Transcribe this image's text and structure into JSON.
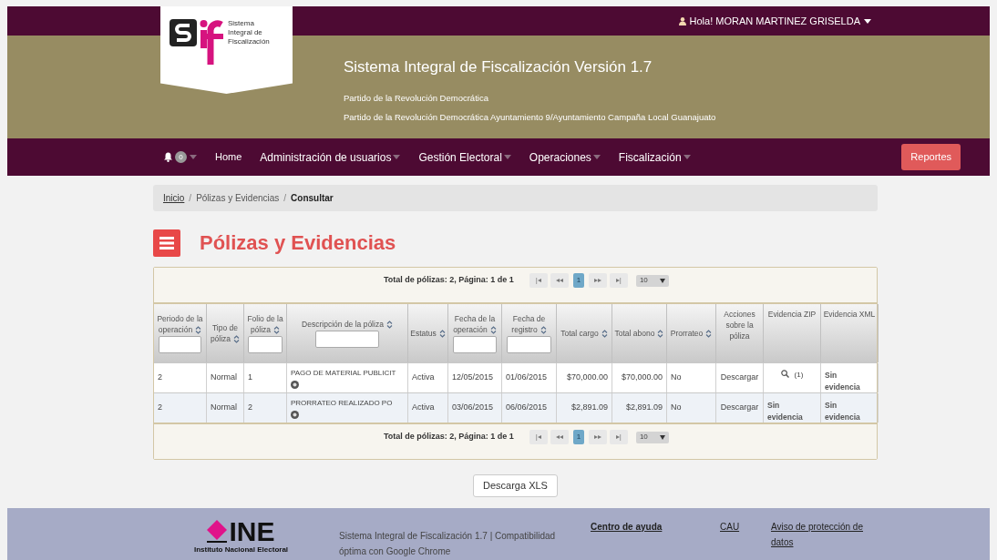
{
  "top_bar": {
    "greeting": "Hola! MORAN MARTINEZ GRISELDA"
  },
  "header": {
    "logo_text": "Sistema Integral de Fiscalización",
    "title": "Sistema Integral de Fiscalización Versión 1.7",
    "lines": [
      "Partido de la Revolución Democrática",
      "Partido de la Revolución Democrática Ayuntamiento 9/Ayuntamiento Campaña Local Guanajuato"
    ]
  },
  "nav": {
    "notification_count": "0",
    "items": [
      {
        "label": "Home",
        "dropdown": false
      },
      {
        "label": "Administración de usuarios",
        "dropdown": true
      },
      {
        "label": "Gestión Electoral",
        "dropdown": true
      },
      {
        "label": "Operaciones",
        "dropdown": true
      },
      {
        "label": "Fiscalización",
        "dropdown": true
      }
    ],
    "action": "Reportes"
  },
  "breadcrumb_separator": "/",
  "breadcrumb": [
    {
      "label": "Inicio",
      "kind": "link"
    },
    {
      "label": "Pólizas y Evidencias",
      "kind": "plain"
    },
    {
      "label": "Consultar",
      "kind": "current"
    }
  ],
  "page_title": "Pólizas y Evidencias",
  "pager_top": {
    "summary": "Total de pólizas: 2, Página: 1 de 1",
    "first": "|◂",
    "prev": "◂◂",
    "pages": [
      {
        "label": "1",
        "selected": true
      }
    ],
    "next": "▸▸",
    "last": "▸|",
    "page_size": "10"
  },
  "pager_bottom": {
    "summary": "Total de pólizas: 2, Página: 1 de 1",
    "first": "|◂",
    "prev": "◂◂",
    "pages": [
      {
        "label": "1",
        "selected": true
      }
    ],
    "next": "▸▸",
    "last": "▸|",
    "page_size": "10"
  },
  "table": {
    "columns": [
      {
        "label": "Periodo de la operación",
        "sortable": true,
        "filter": true
      },
      {
        "label": "Tipo de póliza",
        "sortable": true,
        "filter": false
      },
      {
        "label": "Folio de la póliza",
        "sortable": true,
        "filter": true
      },
      {
        "label": "Descripción de la póliza",
        "sortable": true,
        "filter": true
      },
      {
        "label": "Estatus",
        "sortable": true,
        "filter": false
      },
      {
        "label": "Fecha de la operación",
        "sortable": true,
        "filter": true
      },
      {
        "label": "Fecha de registro",
        "sortable": true,
        "filter": true
      },
      {
        "label": "Total cargo",
        "sortable": true,
        "filter": false
      },
      {
        "label": "Total abono",
        "sortable": true,
        "filter": false
      },
      {
        "label": "Prorrateo",
        "sortable": true,
        "filter": false
      },
      {
        "label": "Acciones sobre la póliza",
        "sortable": false,
        "filter": false
      },
      {
        "label": "Evidencia ZIP",
        "sortable": false,
        "filter": false
      },
      {
        "label": "Evidencia XML",
        "sortable": false,
        "filter": false
      }
    ],
    "rows": [
      {
        "cells": [
          {
            "kind": "text",
            "text": "2"
          },
          {
            "kind": "text",
            "text": "Normal"
          },
          {
            "kind": "text",
            "text": "1"
          },
          {
            "kind": "description",
            "text": "PAGO DE MATERIAL PUBLICIT"
          },
          {
            "kind": "text",
            "text": "Activa"
          },
          {
            "kind": "text",
            "text": "12/05/2015"
          },
          {
            "kind": "text",
            "text": "01/06/2015"
          },
          {
            "kind": "amount",
            "text": "$70,000.00"
          },
          {
            "kind": "amount",
            "text": "$70,000.00"
          },
          {
            "kind": "text",
            "text": "No"
          },
          {
            "kind": "link",
            "text": "Descargar"
          },
          {
            "kind": "evidence",
            "text": "(1)"
          },
          {
            "kind": "note",
            "text": "Sin evidencia"
          }
        ]
      },
      {
        "cells": [
          {
            "kind": "text",
            "text": "2"
          },
          {
            "kind": "text",
            "text": "Normal"
          },
          {
            "kind": "text",
            "text": "2"
          },
          {
            "kind": "description",
            "text": "PRORRATEO REALIZADO PO"
          },
          {
            "kind": "text",
            "text": "Activa"
          },
          {
            "kind": "text",
            "text": "03/06/2015"
          },
          {
            "kind": "text",
            "text": "06/06/2015"
          },
          {
            "kind": "amount",
            "text": "$2,891.09"
          },
          {
            "kind": "amount",
            "text": "$2,891.09"
          },
          {
            "kind": "text",
            "text": "No"
          },
          {
            "kind": "link",
            "text": "Descargar"
          },
          {
            "kind": "note",
            "text": "Sin evidencia"
          },
          {
            "kind": "note",
            "text": "Sin evidencia"
          }
        ]
      }
    ]
  },
  "download_button": "Descarga XLS",
  "footer": {
    "logo_text": "INE",
    "logo_caption": "Instituto Nacional Electoral",
    "description": "Sistema Integral de Fiscalización 1.7 | Compatibilidad óptima con Google Chrome",
    "links": [
      {
        "label": "Centro de ayuda",
        "bold": true
      },
      {
        "label": "CAU",
        "bold": false
      },
      {
        "label": "Aviso de protección de datos",
        "bold": false
      }
    ]
  }
}
